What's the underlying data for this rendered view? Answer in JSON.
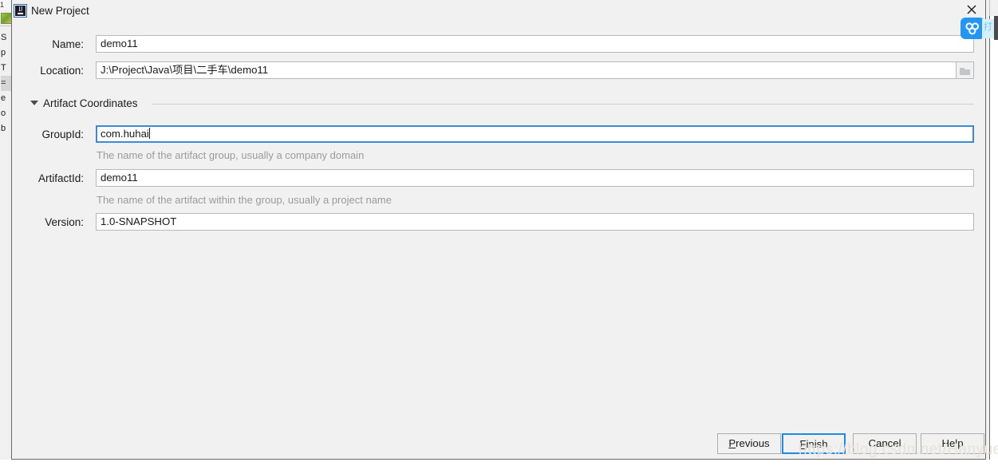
{
  "window": {
    "title": "New Project",
    "app_icon": "intellij-idea-icon",
    "close_icon": "close-icon"
  },
  "form": {
    "name": {
      "label": "Name:",
      "value": "demo11"
    },
    "location": {
      "label": "Location:",
      "value": "J:\\Project\\Java\\项目\\二手车\\demo11",
      "browse_icon": "folder-icon"
    }
  },
  "section": {
    "title": "Artifact Coordinates",
    "collapse_icon": "triangle-down-icon",
    "expanded": true,
    "fields": {
      "group_id": {
        "label": "GroupId:",
        "value": "com.huhai",
        "hint": "The name of the artifact group, usually a company domain",
        "focused": true
      },
      "artifact_id": {
        "label": "ArtifactId:",
        "value": "demo11",
        "hint": "The name of the artifact within the group, usually a project name",
        "focused": false
      },
      "version": {
        "label": "Version:",
        "value": "1.0-SNAPSHOT",
        "hint": "",
        "focused": false
      }
    }
  },
  "buttons": {
    "previous": {
      "label": "Previous",
      "mnemonic": "P",
      "primary": false
    },
    "finish": {
      "label": "Finish",
      "mnemonic": "F",
      "primary": true
    },
    "cancel": {
      "label": "Cancel",
      "mnemonic": "",
      "primary": false
    },
    "help": {
      "label": "Help",
      "mnemonic": "",
      "primary": false
    }
  },
  "overlay": {
    "badge_icon": "baidu-netdisk-cloud-icon",
    "panel_text": "打"
  },
  "watermark": {
    "text": "https://blog.csdn.net/Hanyue"
  },
  "background_window": {
    "strip_text": "1",
    "menu_letters": [
      "S",
      "p",
      "T",
      "=",
      "e",
      "o",
      "b"
    ]
  },
  "colors": {
    "dialog_bg": "#f1f1f1",
    "field_bg": "#ffffff",
    "field_border": "#b9b9b9",
    "focus_blue": "#3d8ad4",
    "primary_border": "#1e8ae5",
    "hint_gray": "#9b9b9b",
    "badge_blue": "#2196f3"
  }
}
